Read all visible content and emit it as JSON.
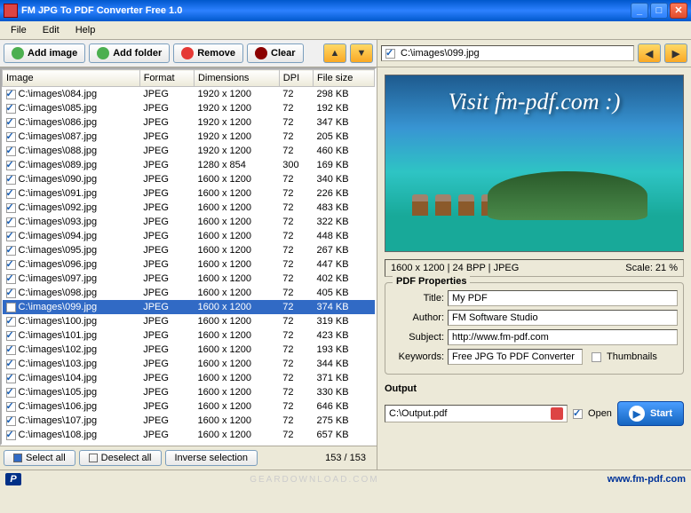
{
  "window": {
    "title": "FM JPG To PDF Converter Free 1.0"
  },
  "menu": {
    "file": "File",
    "edit": "Edit",
    "help": "Help"
  },
  "toolbar": {
    "add_image": "Add image",
    "add_folder": "Add folder",
    "remove": "Remove",
    "clear": "Clear"
  },
  "columns": {
    "image": "Image",
    "format": "Format",
    "dimensions": "Dimensions",
    "dpi": "DPI",
    "filesize": "File size"
  },
  "rows": [
    {
      "path": "C:\\images\\084.jpg",
      "format": "JPEG",
      "dim": "1920 x 1200",
      "dpi": "72",
      "size": "298 KB"
    },
    {
      "path": "C:\\images\\085.jpg",
      "format": "JPEG",
      "dim": "1920 x 1200",
      "dpi": "72",
      "size": "192 KB"
    },
    {
      "path": "C:\\images\\086.jpg",
      "format": "JPEG",
      "dim": "1920 x 1200",
      "dpi": "72",
      "size": "347 KB"
    },
    {
      "path": "C:\\images\\087.jpg",
      "format": "JPEG",
      "dim": "1920 x 1200",
      "dpi": "72",
      "size": "205 KB"
    },
    {
      "path": "C:\\images\\088.jpg",
      "format": "JPEG",
      "dim": "1920 x 1200",
      "dpi": "72",
      "size": "460 KB"
    },
    {
      "path": "C:\\images\\089.jpg",
      "format": "JPEG",
      "dim": "1280 x 854",
      "dpi": "300",
      "size": "169 KB"
    },
    {
      "path": "C:\\images\\090.jpg",
      "format": "JPEG",
      "dim": "1600 x 1200",
      "dpi": "72",
      "size": "340 KB"
    },
    {
      "path": "C:\\images\\091.jpg",
      "format": "JPEG",
      "dim": "1600 x 1200",
      "dpi": "72",
      "size": "226 KB"
    },
    {
      "path": "C:\\images\\092.jpg",
      "format": "JPEG",
      "dim": "1600 x 1200",
      "dpi": "72",
      "size": "483 KB"
    },
    {
      "path": "C:\\images\\093.jpg",
      "format": "JPEG",
      "dim": "1600 x 1200",
      "dpi": "72",
      "size": "322 KB"
    },
    {
      "path": "C:\\images\\094.jpg",
      "format": "JPEG",
      "dim": "1600 x 1200",
      "dpi": "72",
      "size": "448 KB"
    },
    {
      "path": "C:\\images\\095.jpg",
      "format": "JPEG",
      "dim": "1600 x 1200",
      "dpi": "72",
      "size": "267 KB"
    },
    {
      "path": "C:\\images\\096.jpg",
      "format": "JPEG",
      "dim": "1600 x 1200",
      "dpi": "72",
      "size": "447 KB"
    },
    {
      "path": "C:\\images\\097.jpg",
      "format": "JPEG",
      "dim": "1600 x 1200",
      "dpi": "72",
      "size": "402 KB"
    },
    {
      "path": "C:\\images\\098.jpg",
      "format": "JPEG",
      "dim": "1600 x 1200",
      "dpi": "72",
      "size": "405 KB"
    },
    {
      "path": "C:\\images\\099.jpg",
      "format": "JPEG",
      "dim": "1600 x 1200",
      "dpi": "72",
      "size": "374 KB",
      "selected": true
    },
    {
      "path": "C:\\images\\100.jpg",
      "format": "JPEG",
      "dim": "1600 x 1200",
      "dpi": "72",
      "size": "319 KB"
    },
    {
      "path": "C:\\images\\101.jpg",
      "format": "JPEG",
      "dim": "1600 x 1200",
      "dpi": "72",
      "size": "423 KB"
    },
    {
      "path": "C:\\images\\102.jpg",
      "format": "JPEG",
      "dim": "1600 x 1200",
      "dpi": "72",
      "size": "193 KB"
    },
    {
      "path": "C:\\images\\103.jpg",
      "format": "JPEG",
      "dim": "1600 x 1200",
      "dpi": "72",
      "size": "344 KB"
    },
    {
      "path": "C:\\images\\104.jpg",
      "format": "JPEG",
      "dim": "1600 x 1200",
      "dpi": "72",
      "size": "371 KB"
    },
    {
      "path": "C:\\images\\105.jpg",
      "format": "JPEG",
      "dim": "1600 x 1200",
      "dpi": "72",
      "size": "330 KB"
    },
    {
      "path": "C:\\images\\106.jpg",
      "format": "JPEG",
      "dim": "1600 x 1200",
      "dpi": "72",
      "size": "646 KB"
    },
    {
      "path": "C:\\images\\107.jpg",
      "format": "JPEG",
      "dim": "1600 x 1200",
      "dpi": "72",
      "size": "275 KB"
    },
    {
      "path": "C:\\images\\108.jpg",
      "format": "JPEG",
      "dim": "1600 x 1200",
      "dpi": "72",
      "size": "657 KB"
    }
  ],
  "selectbar": {
    "select_all": "Select all",
    "deselect_all": "Deselect all",
    "inverse": "Inverse selection",
    "counter": "153 / 153"
  },
  "preview": {
    "path": "C:\\images\\099.jpg",
    "banner": "Visit fm-pdf.com :)",
    "info": "1600 x 1200 | 24 BPP | JPEG",
    "scale": "Scale: 21 %"
  },
  "props": {
    "group": "PDF Properties",
    "title_lbl": "Title:",
    "title": "My PDF",
    "author_lbl": "Author:",
    "author": "FM Software Studio",
    "subject_lbl": "Subject:",
    "subject": "http://www.fm-pdf.com",
    "keywords_lbl": "Keywords:",
    "keywords": "Free JPG To PDF Converter",
    "thumbnails": "Thumbnails"
  },
  "output": {
    "label": "Output",
    "path": "C:\\Output.pdf",
    "open": "Open",
    "start": "Start"
  },
  "status": {
    "watermark": "GEARDOWNLOAD.COM",
    "link": "www.fm-pdf.com"
  }
}
